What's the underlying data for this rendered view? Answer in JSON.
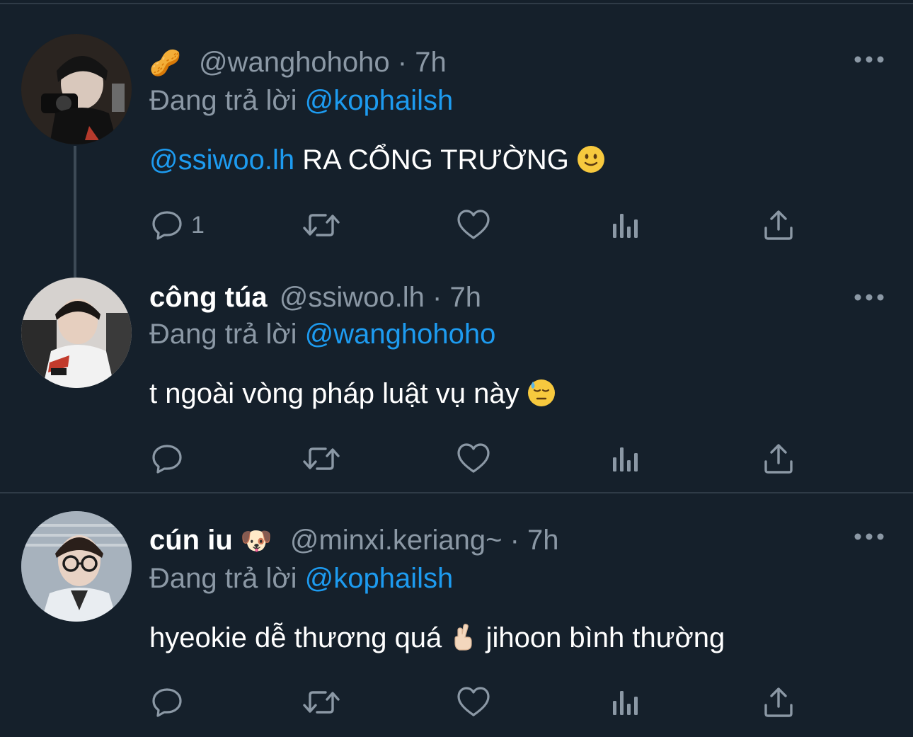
{
  "colors": {
    "background": "#15202b",
    "secondary_text": "#8b98a5",
    "mention": "#1d9bf0",
    "divider": "#2f3b47"
  },
  "tweets": [
    {
      "name": "",
      "name_emoji": "🥜",
      "handle": "@wanghohoho",
      "dot": "·",
      "time": "7h",
      "reply_prefix": "Đang trả lời",
      "reply_to": "@kophailsh",
      "body_mention": "@ssiwoo.lh",
      "body_text": "RA CỔNG TRƯỜNG",
      "body_emoji": "slightly-smiling-face",
      "reply_count": "1",
      "avatar_icon": "avatar-camera-person"
    },
    {
      "name": "công túa",
      "name_emoji": "",
      "handle": "@ssiwoo.lh",
      "dot": "·",
      "time": "7h",
      "reply_prefix": "Đang trả lời",
      "reply_to": "@wanghohoho",
      "body_text": "t ngoài vòng pháp luật vụ này",
      "body_emoji": "downcast-sweat-face",
      "reply_count": "",
      "avatar_icon": "avatar-person-jacket"
    },
    {
      "name": "cún iu",
      "name_emoji": "🐶",
      "handle": "@minxi.keriang~",
      "dot": "·",
      "time": "7h",
      "reply_prefix": "Đang trả lời",
      "reply_to": "@kophailsh",
      "body_text_1": "hyeokie dễ thương quá",
      "body_emoji": "crossed-fingers",
      "body_text_2": "jihoon bình thường",
      "reply_count": "",
      "avatar_icon": "avatar-person-glasses"
    }
  ]
}
